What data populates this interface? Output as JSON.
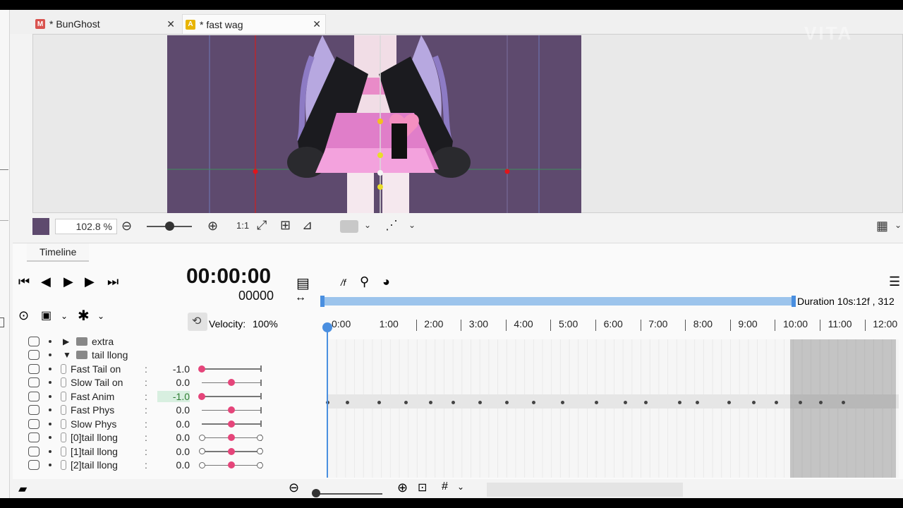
{
  "tabs": [
    {
      "label": "* BunGhost",
      "badge": "M",
      "badge_color": "#d9534f"
    },
    {
      "label": "* fast wag",
      "badge": "A",
      "badge_color": "#e8b400"
    }
  ],
  "watermark": "VITA",
  "view": {
    "zoom": "102.8",
    "zoom_unit": "%",
    "ratio_label": "1:1",
    "canvas_color": "#5e4a6e"
  },
  "timeline": {
    "panel_title": "Timeline",
    "timecode": "00:00:00",
    "frame": "00000",
    "velocity_label": "Velocity:",
    "velocity_value": "100%",
    "fps_label": "/f",
    "duration": "Duration 10s:12f , 312",
    "ruler": [
      "0:00",
      "1:00",
      "2:00",
      "3:00",
      "4:00",
      "5:00",
      "6:00",
      "7:00",
      "8:00",
      "9:00",
      "10:00",
      "11:00",
      "12:00"
    ]
  },
  "tree": {
    "folder_extra": "extra",
    "folder_tail": "tail llong",
    "params": [
      {
        "name": "Fast Tail on",
        "value": "-1.0",
        "knob": 0.0,
        "ends": false
      },
      {
        "name": "Slow Tail on",
        "value": "0.0",
        "knob": 0.5,
        "ends": false
      },
      {
        "name": "Fast Anim",
        "value": "-1.0",
        "knob": 0.0,
        "ends": false,
        "highlight": true
      },
      {
        "name": "Fast Phys",
        "value": "0.0",
        "knob": 0.5,
        "ends": false
      },
      {
        "name": "Slow Phys",
        "value": "0.0",
        "knob": 0.5,
        "ends": false
      },
      {
        "name": "[0]tail llong",
        "value": "0.0",
        "knob": 0.5,
        "ends": true
      },
      {
        "name": "[1]tail llong",
        "value": "0.0",
        "knob": 0.5,
        "ends": true
      },
      {
        "name": "[2]tail llong",
        "value": "0.0",
        "knob": 0.5,
        "ends": true
      }
    ]
  },
  "keyframes_seconds": [
    0,
    0.45,
    1.15,
    1.75,
    2.3,
    2.8,
    3.4,
    4.0,
    4.6,
    5.25,
    6.0,
    6.65,
    7.1,
    7.85,
    8.25,
    8.95,
    9.5,
    10.0,
    10.55,
    11.0,
    11.5
  ],
  "colors": {
    "accent_blue": "#4a8fe0",
    "knob_pink": "#e5457a",
    "range_bar": "#9cc4ec"
  }
}
